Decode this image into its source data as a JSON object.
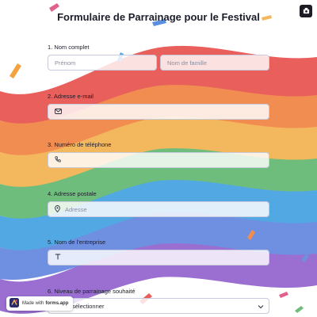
{
  "form": {
    "title": "Formulaire de Parrainage pour le Festival"
  },
  "questions": [
    {
      "label": "1.  Nom complet",
      "first_placeholder": "Prénom",
      "last_placeholder": "Nom de famille"
    },
    {
      "label": "2.  Adresse e-mail",
      "placeholder": ""
    },
    {
      "label": "3.  Numéro de téléphone",
      "placeholder": ""
    },
    {
      "label": "4.  Adresse postale",
      "placeholder": "Adresse"
    },
    {
      "label": "5.  Nom de l'entreprise",
      "placeholder": ""
    },
    {
      "label": "6.  Niveau de parrainage souhaité",
      "select_value": "sélectionner"
    }
  ],
  "footer": {
    "made_with": "Made with",
    "brand": "forms.app"
  },
  "icons": [
    "mail-icon",
    "phone-icon",
    "location-pin-icon",
    "text-t-icon",
    "chevron-down-icon",
    "expand-icon",
    "forms-app-logo-icon"
  ],
  "colors": {
    "rainbow": [
      "#e85f5c",
      "#f28d52",
      "#f3b85e",
      "#6fbd7c",
      "#52a8e3",
      "#6f8fe0",
      "#9a6fd1"
    ],
    "field_border": "#c7c9dd"
  }
}
